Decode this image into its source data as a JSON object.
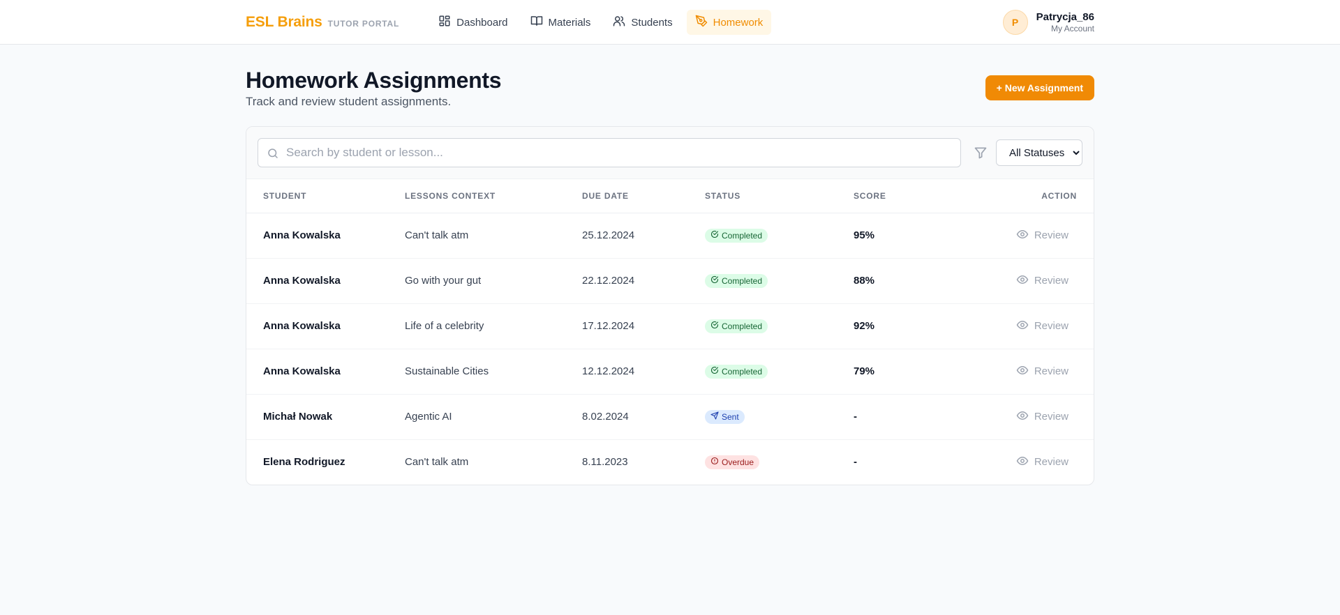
{
  "brand": {
    "name": "ESL Brains",
    "sub": "TUTOR PORTAL"
  },
  "nav": [
    {
      "label": "Dashboard",
      "icon": "grid-icon",
      "active": false
    },
    {
      "label": "Materials",
      "icon": "book-icon",
      "active": false
    },
    {
      "label": "Students",
      "icon": "users-icon",
      "active": false
    },
    {
      "label": "Homework",
      "icon": "pen-tool-icon",
      "active": true
    }
  ],
  "account": {
    "initial": "P",
    "name": "Patrycja_86",
    "sub": "My Account"
  },
  "page": {
    "title": "Homework Assignments",
    "subtitle": "Track and review student assignments.",
    "new_button": "+ New Assignment"
  },
  "search": {
    "placeholder": "Search by student or lesson...",
    "value": ""
  },
  "filter": {
    "selected": "All Statuses"
  },
  "table": {
    "headers": {
      "student": "STUDENT",
      "lesson": "LESSONS CONTEXT",
      "due": "DUE DATE",
      "status": "STATUS",
      "score": "SCORE",
      "action": "ACTION"
    },
    "rows": [
      {
        "student": "Anna Kowalska",
        "lesson": "Can't talk atm",
        "due": "25.12.2024",
        "status": "Completed",
        "status_type": "completed",
        "score": "95%",
        "action": "Review"
      },
      {
        "student": "Anna Kowalska",
        "lesson": "Go with your gut",
        "due": "22.12.2024",
        "status": "Completed",
        "status_type": "completed",
        "score": "88%",
        "action": "Review"
      },
      {
        "student": "Anna Kowalska",
        "lesson": "Life of a celebrity",
        "due": "17.12.2024",
        "status": "Completed",
        "status_type": "completed",
        "score": "92%",
        "action": "Review"
      },
      {
        "student": "Anna Kowalska",
        "lesson": "Sustainable Cities",
        "due": "12.12.2024",
        "status": "Completed",
        "status_type": "completed",
        "score": "79%",
        "action": "Review"
      },
      {
        "student": "Michał Nowak",
        "lesson": "Agentic AI",
        "due": "8.02.2024",
        "status": "Sent",
        "status_type": "sent",
        "score": "-",
        "action": "Review"
      },
      {
        "student": "Elena Rodriguez",
        "lesson": "Can't talk atm",
        "due": "8.11.2023",
        "status": "Overdue",
        "status_type": "overdue",
        "score": "-",
        "action": "Review"
      }
    ]
  },
  "colors": {
    "accent": "#f59e0b",
    "completed_bg": "#dcfce7",
    "sent_bg": "#dbeafe",
    "overdue_bg": "#fee2e2"
  }
}
